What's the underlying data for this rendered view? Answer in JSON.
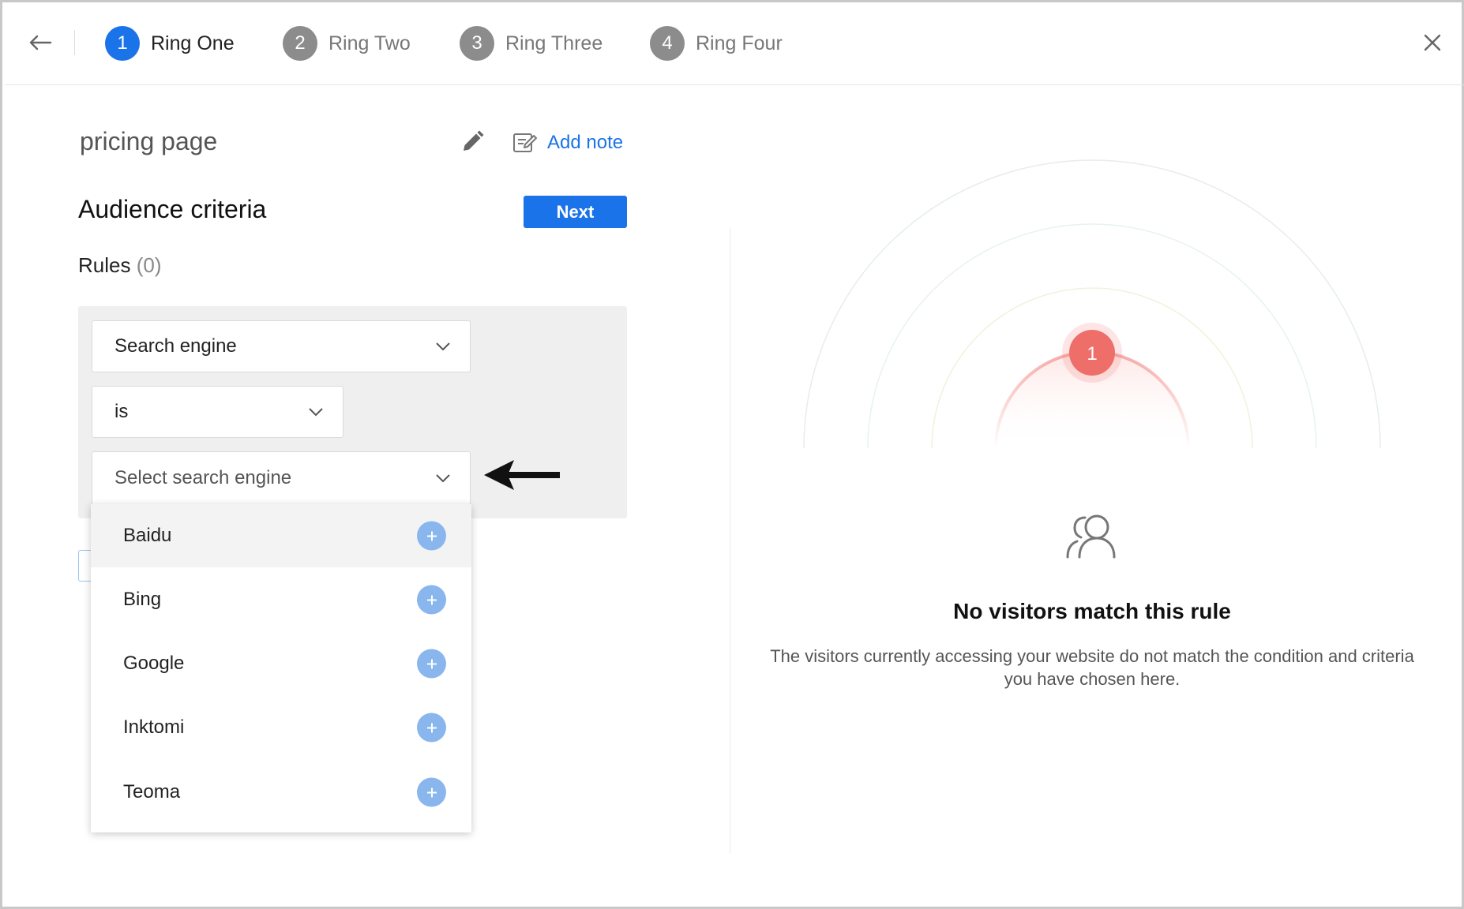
{
  "header": {
    "steps": [
      {
        "num": "1",
        "label": "Ring One"
      },
      {
        "num": "2",
        "label": "Ring Two"
      },
      {
        "num": "3",
        "label": "Ring Three"
      },
      {
        "num": "4",
        "label": "Ring Four"
      }
    ],
    "active_step": "1"
  },
  "page": {
    "name": "pricing page",
    "add_note": "Add note"
  },
  "audience": {
    "title": "Audience criteria",
    "next_label": "Next",
    "rules_label": "Rules",
    "rules_count": "(0)"
  },
  "rule": {
    "attribute": "Search engine",
    "operator": "is",
    "value_placeholder": "Select search engine"
  },
  "dropdown": {
    "options": [
      "Baidu",
      "Bing",
      "Google",
      "Inktomi",
      "Teoma"
    ],
    "highlighted": "Baidu"
  },
  "preview": {
    "ring_marker": "1",
    "title": "No visitors match this rule",
    "description_line1": "The visitors currently accessing your website do not match the condition and criteria",
    "description_line2": "you have chosen here."
  },
  "colors": {
    "accent": "#1a73e8",
    "marker": "#ee6e6a",
    "plus": "#8ab6ee"
  }
}
